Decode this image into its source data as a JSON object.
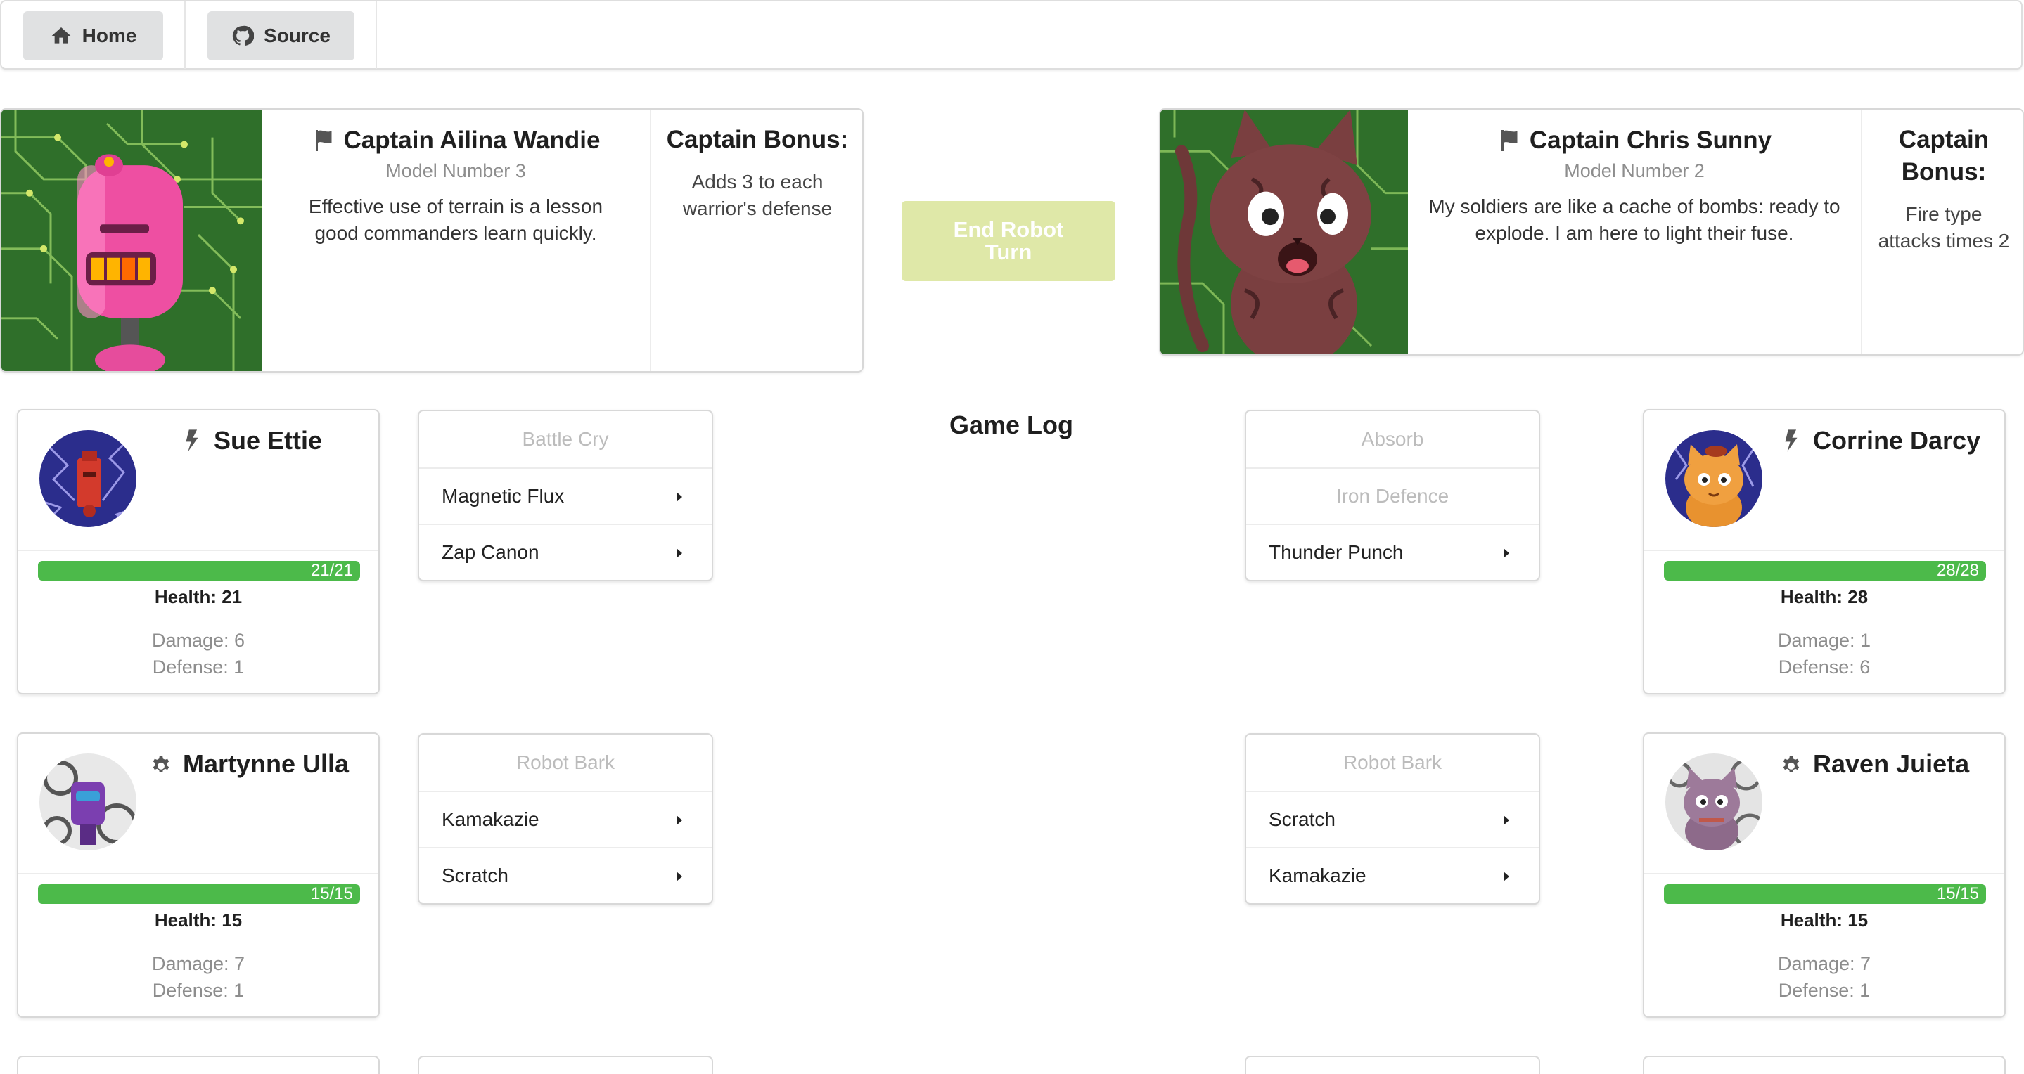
{
  "menu": {
    "home_label": "Home",
    "source_label": "Source"
  },
  "captains": {
    "left": {
      "name": "Captain Ailina Wandie",
      "model": "Model Number 3",
      "quote": "Effective use of terrain is a lesson good commanders learn quickly.",
      "bonus_title": "Captain Bonus:",
      "bonus_text": "Adds 3 to each warrior's defense",
      "icon": "flag-icon"
    },
    "right": {
      "name": "Captain Chris Sunny",
      "model": "Model Number 2",
      "quote": "My soldiers are like a cache of bombs: ready to explode. I am here to light their fuse.",
      "bonus_title": "Captain Bonus:",
      "bonus_text": "Fire type attacks times 2",
      "icon": "flag-icon"
    }
  },
  "end_turn_label": "End Robot Turn",
  "game_log_title": "Game Log",
  "warriors": {
    "left1": {
      "name": "Sue Ettie",
      "type_icon": "lightning-icon",
      "health_bar": "21/21",
      "health_fraction": 1.0,
      "health": "Health: 21",
      "damage": "Damage: 6",
      "defense": "Defense: 1"
    },
    "left2": {
      "name": "Martynne Ulla",
      "type_icon": "gear-icon",
      "health_bar": "15/15",
      "health_fraction": 1.0,
      "health": "Health: 15",
      "damage": "Damage: 7",
      "defense": "Defense: 1"
    },
    "right1": {
      "name": "Corrine Darcy",
      "type_icon": "lightning-icon",
      "health_bar": "28/28",
      "health_fraction": 1.0,
      "health": "Health: 28",
      "damage": "Damage: 1",
      "defense": "Defense: 6"
    },
    "right2": {
      "name": "Raven Juieta",
      "type_icon": "gear-icon",
      "health_bar": "15/15",
      "health_fraction": 1.0,
      "health": "Health: 15",
      "damage": "Damage: 7",
      "defense": "Defense: 1"
    }
  },
  "abilities": {
    "left1": [
      {
        "label": "Battle Cry",
        "enabled": false
      },
      {
        "label": "Magnetic Flux",
        "enabled": true
      },
      {
        "label": "Zap Canon",
        "enabled": true
      }
    ],
    "left2": [
      {
        "label": "Robot Bark",
        "enabled": false
      },
      {
        "label": "Kamakazie",
        "enabled": true
      },
      {
        "label": "Scratch",
        "enabled": true
      }
    ],
    "right1": [
      {
        "label": "Absorb",
        "enabled": false
      },
      {
        "label": "Iron Defence",
        "enabled": false
      },
      {
        "label": "Thunder Punch",
        "enabled": true
      }
    ],
    "right2": [
      {
        "label": "Robot Bark",
        "enabled": false
      },
      {
        "label": "Scratch",
        "enabled": true
      },
      {
        "label": "Kamakazie",
        "enabled": true
      }
    ]
  },
  "colors": {
    "health_bar": "#4cba4a",
    "end_turn_button": "#dfe8a8",
    "menu_button": "#e0e1e2"
  }
}
